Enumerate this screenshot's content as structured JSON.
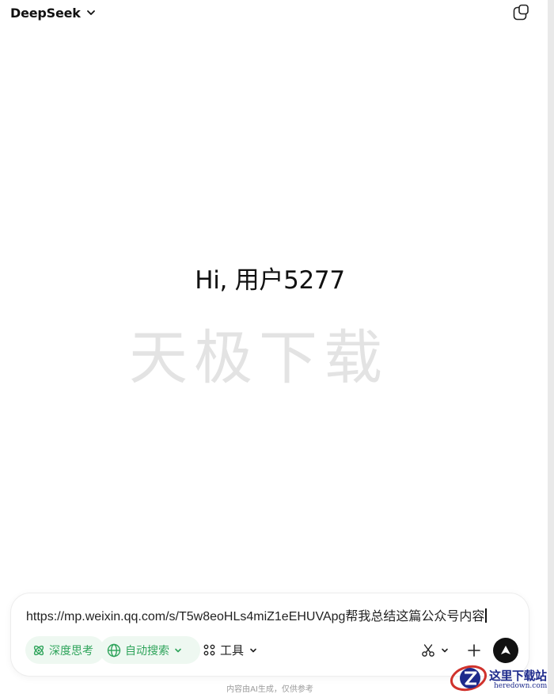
{
  "header": {
    "model_name": "DeepSeek"
  },
  "main": {
    "greeting": "Hi, 用户5277",
    "watermark": "天极下载"
  },
  "composer": {
    "input_value": "https://mp.weixin.qq.com/s/T5w8eoHLs4miZ1eEHUVApg帮我总结这篇公众号内容",
    "deep_think_label": "深度思考",
    "web_search_label": "自动搜索",
    "tools_label": "工具"
  },
  "footer": {
    "disclaimer": "内容由AI生成，仅供参考"
  },
  "corner_logo": {
    "cn_text": "这里下载站",
    "en_text": "heredown.com"
  },
  "colors": {
    "accent_green": "#2fa45b",
    "pill_bg": "#eef8f1",
    "send_bg": "#111111"
  },
  "icons": [
    "chevron-down-icon",
    "new-chat-icon",
    "atom-icon",
    "globe-icon",
    "tools-grid-icon",
    "scissors-icon",
    "plus-icon",
    "send-arrow-icon"
  ]
}
